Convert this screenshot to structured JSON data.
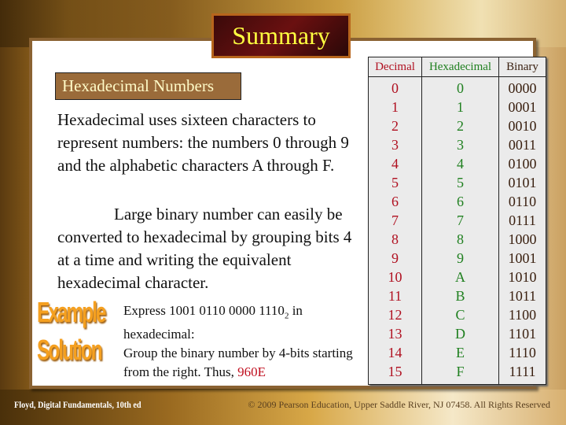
{
  "title": "Summary",
  "subheading": "Hexadecimal Numbers",
  "paragraph1": "Hexadecimal uses sixteen characters to represent numbers: the numbers 0 through 9 and the alphabetic characters A through F.",
  "paragraph2": "Large binary number can easily be converted to hexadecimal by grouping bits 4 at a time and writing the equivalent hexadecimal character.",
  "example": {
    "badge": "Example",
    "text_before": "Express 1001 0110 0000 1110",
    "subscript": "2",
    "text_after": " in hexadecimal:"
  },
  "solution": {
    "badge": "Solution",
    "text": "Group the binary number by 4-bits starting from the right. Thus, ",
    "answer": "960E"
  },
  "table": {
    "headers": [
      "Decimal",
      "Hexadecimal",
      "Binary"
    ],
    "rows": [
      [
        "0",
        "0",
        "0000"
      ],
      [
        "1",
        "1",
        "0001"
      ],
      [
        "2",
        "2",
        "0010"
      ],
      [
        "3",
        "3",
        "0011"
      ],
      [
        "4",
        "4",
        "0100"
      ],
      [
        "5",
        "5",
        "0101"
      ],
      [
        "6",
        "6",
        "0110"
      ],
      [
        "7",
        "7",
        "0111"
      ],
      [
        "8",
        "8",
        "1000"
      ],
      [
        "9",
        "9",
        "1001"
      ],
      [
        "10",
        "A",
        "1010"
      ],
      [
        "11",
        "B",
        "1011"
      ],
      [
        "12",
        "C",
        "1100"
      ],
      [
        "13",
        "D",
        "1101"
      ],
      [
        "14",
        "E",
        "1110"
      ],
      [
        "15",
        "F",
        "1111"
      ]
    ]
  },
  "footer": {
    "left": "Floyd, Digital Fundamentals, 10th ed",
    "right": "© 2009 Pearson Education, Upper Saddle River, NJ 07458. All Rights Reserved"
  },
  "colors": {
    "decimal": "#b01020",
    "hex": "#208020",
    "binary": "#3a2010",
    "answer": "#c01020",
    "title_text": "#ffff40"
  }
}
